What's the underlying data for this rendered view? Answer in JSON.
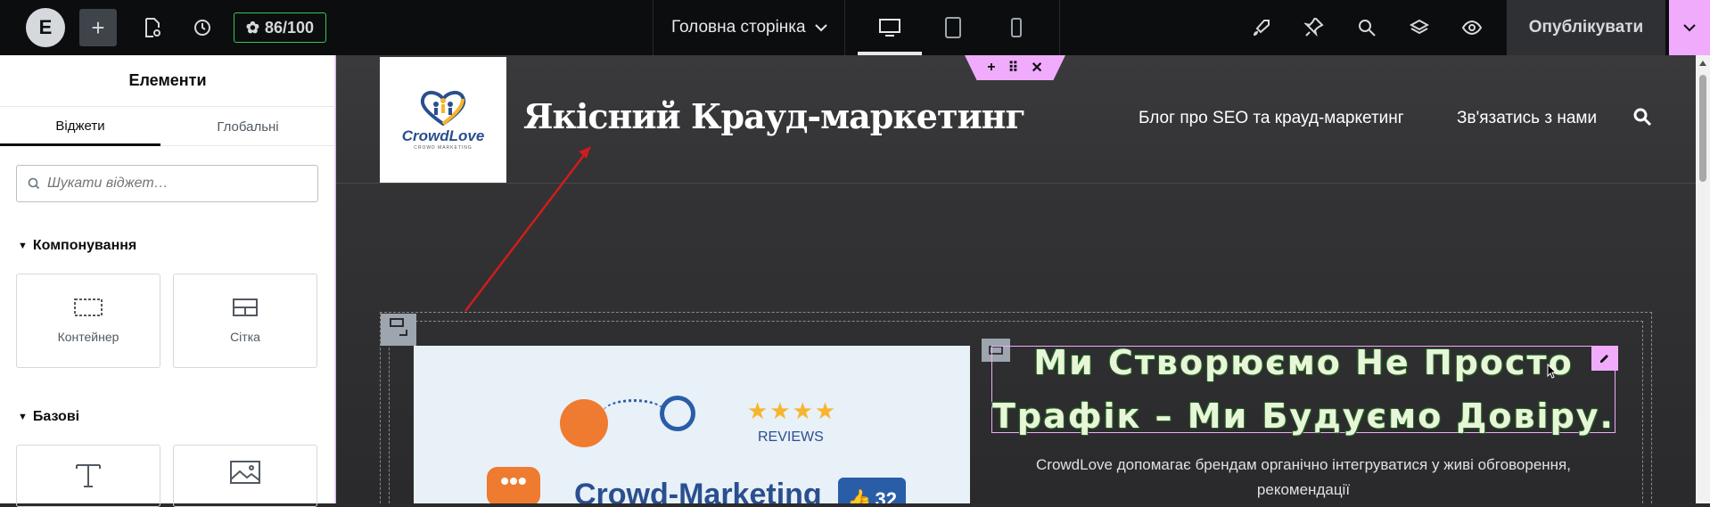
{
  "topbar": {
    "score": "86/100",
    "page_name": "Головна сторінка",
    "publish_label": "Опублікувати"
  },
  "panel": {
    "title": "Елементи",
    "tabs": [
      "Віджети",
      "Глобальні"
    ],
    "search_placeholder": "Шукати віджет…",
    "sections": {
      "layout": "Компонування",
      "basic": "Базові"
    },
    "widgets": {
      "container": "Контейнер",
      "grid": "Сітка"
    }
  },
  "site": {
    "brand": "CrowdLove",
    "tagline": "CROWD MARKETING",
    "title": "Якісний Крауд-маркетинг",
    "nav": [
      "Блог про SEO та крауд-маркетинг",
      "Зв'язатись з нами"
    ],
    "heading_line1": "Ми Створюємо Не Просто",
    "heading_line2": "Трафік – Ми Будуємо Довіру.",
    "paragraph": "CrowdLove допомагає брендам органічно інтегруватися у живі обговорення, рекомендації",
    "image": {
      "reviews": "REVIEWS",
      "stars": "★★★★",
      "title": "Crowd-Marketing",
      "likes": "32"
    }
  },
  "colors": {
    "accent": "#f0abfc",
    "score_green": "#34c759",
    "topbar_bg": "#0c0d0e"
  }
}
